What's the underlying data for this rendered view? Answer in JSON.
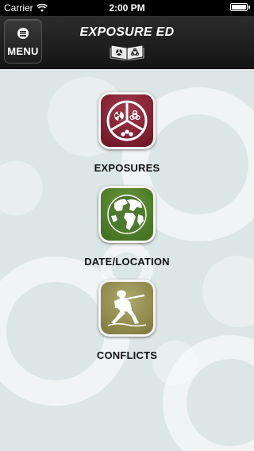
{
  "status_bar": {
    "carrier": "Carrier",
    "time": "2:00 PM"
  },
  "header": {
    "title": "EXPOSURE ED",
    "menu_label": "MENU"
  },
  "items": [
    {
      "label": "EXPOSURES",
      "icon": "hazard-symbols-icon",
      "color": "#7d1f2c"
    },
    {
      "label": "DATE/LOCATION",
      "icon": "globe-icon",
      "color": "#4d7a2c"
    },
    {
      "label": "CONFLICTS",
      "icon": "soldier-icon",
      "color": "#8f8a50"
    }
  ],
  "colors": {
    "background": "#dde6e6",
    "nav": "#1c1c1c"
  }
}
